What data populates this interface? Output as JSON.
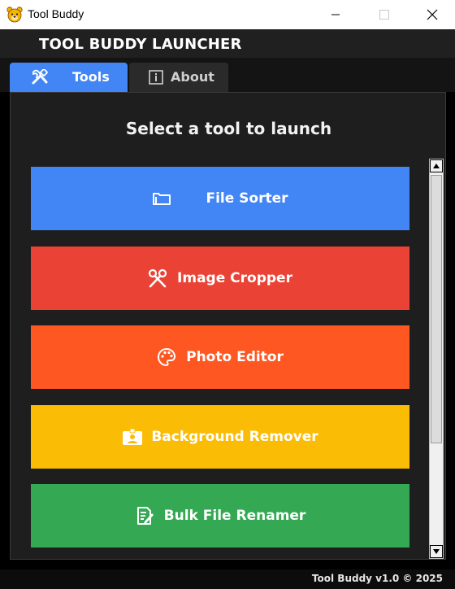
{
  "window": {
    "title": "Tool Buddy",
    "app_icon": "bear-face-icon"
  },
  "header": {
    "title": "TOOL BUDDY LAUNCHER"
  },
  "tabs": [
    {
      "label": "Tools",
      "icon": "tools-icon",
      "active": true
    },
    {
      "label": "About",
      "icon": "info-icon",
      "active": false
    }
  ],
  "main": {
    "heading": "Select a tool to launch",
    "tools": [
      {
        "label": "File Sorter",
        "icon": "folder-icon",
        "color": "#4285f4"
      },
      {
        "label": "Image Cropper",
        "icon": "scissors-icon",
        "color": "#ea4335"
      },
      {
        "label": "Photo Editor",
        "icon": "palette-icon",
        "color": "#ff5722"
      },
      {
        "label": "Background Remover",
        "icon": "id-card-icon",
        "color": "#fbbc05"
      },
      {
        "label": "Bulk File Renamer",
        "icon": "edit-document-icon",
        "color": "#34a853"
      }
    ]
  },
  "footer": {
    "version_text": "Tool Buddy v1.0 © 2025"
  },
  "colors": {
    "accent": "#4285f4",
    "background": "#1e1e1e"
  }
}
